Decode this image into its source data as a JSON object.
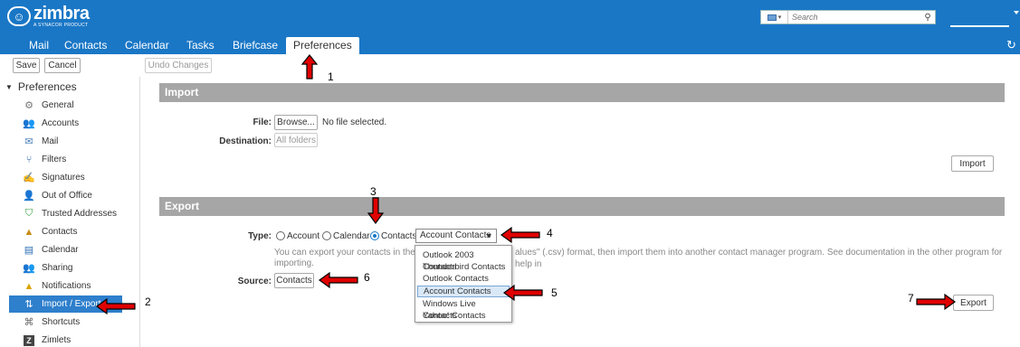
{
  "header": {
    "logo_name": "zimbra",
    "logo_sub": "A SYNACOR PRODUCT",
    "search_placeholder": "Search"
  },
  "tabs": [
    {
      "label": "Mail"
    },
    {
      "label": "Contacts"
    },
    {
      "label": "Calendar"
    },
    {
      "label": "Tasks"
    },
    {
      "label": "Briefcase"
    },
    {
      "label": "Preferences",
      "active": true
    }
  ],
  "toolbar": {
    "save_label": "Save",
    "cancel_label": "Cancel",
    "undo_label": "Undo Changes"
  },
  "sidebar": {
    "title": "Preferences",
    "items": [
      {
        "label": "General",
        "icon": "gear-icon"
      },
      {
        "label": "Accounts",
        "icon": "accounts-icon"
      },
      {
        "label": "Mail",
        "icon": "mail-icon"
      },
      {
        "label": "Filters",
        "icon": "filter-icon"
      },
      {
        "label": "Signatures",
        "icon": "signature-icon"
      },
      {
        "label": "Out of Office",
        "icon": "out-of-office-icon"
      },
      {
        "label": "Trusted Addresses",
        "icon": "shield-icon"
      },
      {
        "label": "Contacts",
        "icon": "contacts-icon"
      },
      {
        "label": "Calendar",
        "icon": "calendar-icon"
      },
      {
        "label": "Sharing",
        "icon": "sharing-icon"
      },
      {
        "label": "Notifications",
        "icon": "bell-icon"
      },
      {
        "label": "Import / Export",
        "icon": "import-export-icon",
        "active": true
      },
      {
        "label": "Shortcuts",
        "icon": "shortcuts-icon"
      },
      {
        "label": "Zimlets",
        "icon": "zimlets-icon"
      }
    ]
  },
  "import": {
    "title": "Import",
    "file_label": "File:",
    "browse_label": "Browse...",
    "no_file": "No file selected.",
    "destination_label": "Destination:",
    "destination_value": "All folders",
    "import_button": "Import"
  },
  "export": {
    "title": "Export",
    "type_label": "Type:",
    "type_options": [
      "Account",
      "Calendar",
      "Contacts"
    ],
    "selected_type": "Contacts",
    "format_value": "Account Contacts",
    "help_text_1": "You can export your contacts in the sta",
    "help_text_2": "alues\" (.csv) format, then import them into another contact manager program. See documentation in the other program for help in",
    "help_text_3": "importing.",
    "source_label": "Source:",
    "source_value": "Contacts",
    "export_button": "Export",
    "format_options": [
      "Outlook 2003 Contacts",
      "Thunderbird Contacts",
      "Outlook Contacts",
      "Account Contacts",
      "Windows Live Contacts",
      "Yahoo! Contacts"
    ],
    "selected_format": "Account Contacts"
  },
  "annotations": [
    "1",
    "2",
    "3",
    "4",
    "5",
    "6",
    "7"
  ],
  "colors": {
    "brand": "#1a77c6",
    "section_bar": "#a6a6a6",
    "active_item": "#2e7fcc",
    "arrow": "#e00000"
  }
}
